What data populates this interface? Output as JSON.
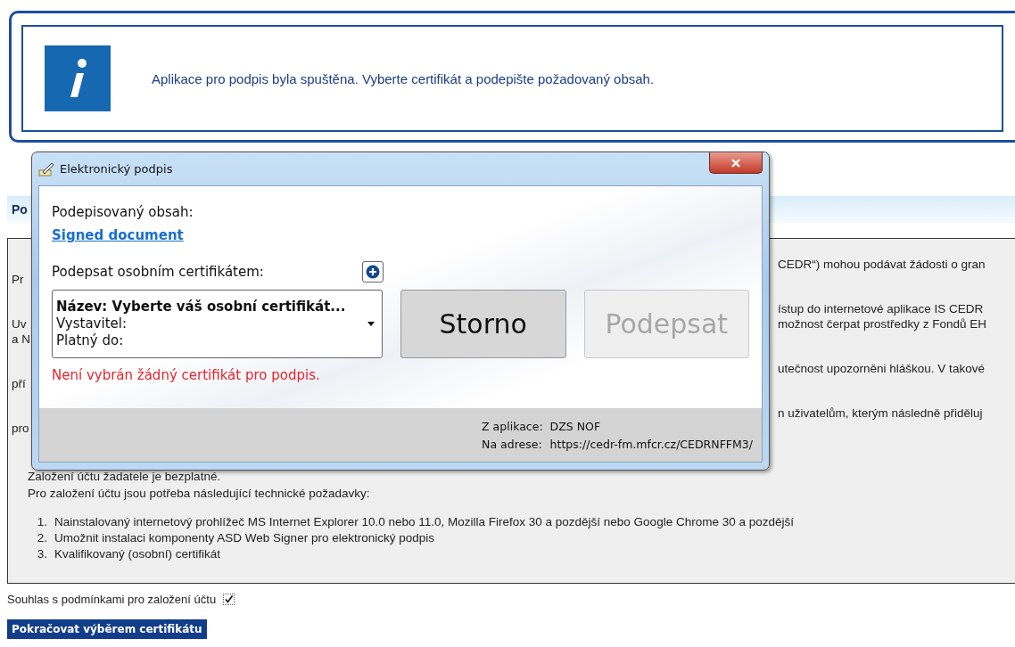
{
  "info_banner": {
    "message": "Aplikace pro podpis byla spuštěna. Vyberte certifikát a podepište požadovaný obsah."
  },
  "page": {
    "section_title": "Po",
    "paragraphs": [
      {
        "lines": [
          {
            "right": "CEDR“) mohou podávat žádosti o gran"
          },
          {
            "left": "Pr"
          }
        ]
      },
      {
        "lines": [
          {
            "right": "ístup do internetové aplikace IS CEDR"
          },
          {
            "left": "Uv",
            "right": "možnost čerpat prostředky z Fondů EH"
          },
          {
            "left": "a N"
          }
        ]
      },
      {
        "lines": [
          {
            "right": "utečnost upozorněni hláškou. V takové"
          },
          {
            "left": "pří"
          }
        ]
      },
      {
        "lines": [
          {
            "right": "n uživatelům, kterým následně přiděluj"
          },
          {
            "left": "pro"
          }
        ]
      }
    ],
    "note": "Založení účtu žadatele je bezplatné.",
    "requirements_intro": "Pro založení účtu jsou potřeba následující technické požadavky:",
    "requirements": [
      {
        "number": "1.",
        "text": "Nainstalovaný internetový prohlížeč MS Internet Explorer 10.0 nebo 11.0, Mozilla Firefox 30 a pozdější nebo Google Chrome 30 a pozdější"
      },
      {
        "number": "2.",
        "text": "Umožnit instalaci komponenty ASD Web Signer pro elektronický podpis"
      },
      {
        "number": "3.",
        "text": "Kvalifikovaný (osobní) certifikát"
      }
    ],
    "agreement": {
      "label": "Souhlas s podmínkami pro založení účtu",
      "checked": true
    },
    "continue_button": "Pokračovat výběrem certifikátu"
  },
  "dialog": {
    "title": "Elektronický podpis",
    "content_label": "Podepisovaný obsah:",
    "document_link": "Signed document",
    "certificate_label": "Podepsat osobním certifikátem:",
    "certificate_select": {
      "name": "Název: Vyberte váš osobní certifikát...",
      "issuer": "Vystavitel:",
      "valid_until": "Platný do:"
    },
    "error": "Není vybrán žádný certifikát pro podpis.",
    "buttons": [
      {
        "label": "Storno",
        "disabled": false
      },
      {
        "label": "Podepsat",
        "disabled": true
      }
    ],
    "footer": [
      {
        "label": "Z aplikace:",
        "value": "DZS NOF"
      },
      {
        "label": "Na adrese:",
        "value": "https://cedr-fm.mfcr.cz/CEDRNFFM3/"
      }
    ]
  }
}
